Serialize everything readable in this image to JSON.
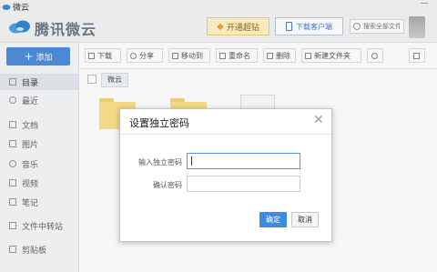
{
  "window": {
    "title": "微云"
  },
  "header": {
    "brand": "腾讯微云",
    "vip_label": "开通超钻",
    "download_client_label": "下载客户端",
    "search_placeholder": "搜索全部文件"
  },
  "sidebar": {
    "add_label": "添加",
    "items": [
      {
        "label": "目录",
        "icon": "directory-icon"
      },
      {
        "label": "最近",
        "icon": "clock-icon"
      },
      {
        "label": "文档",
        "icon": "document-icon"
      },
      {
        "label": "图片",
        "icon": "image-icon"
      },
      {
        "label": "音乐",
        "icon": "music-icon"
      },
      {
        "label": "视频",
        "icon": "video-icon"
      },
      {
        "label": "笔记",
        "icon": "note-icon"
      },
      {
        "label": "文件中转站",
        "icon": "transfer-icon"
      },
      {
        "label": "剪贴板",
        "icon": "clipboard-icon"
      }
    ]
  },
  "toolbar": {
    "download": "下载",
    "share": "分享",
    "move": "移动到",
    "rename": "重命名",
    "delete": "删除",
    "new_folder": "新建文件夹"
  },
  "breadcrumb": {
    "root": "微云"
  },
  "dialog": {
    "title": "设置独立密码",
    "password_label": "输入独立密码",
    "confirm_label": "确认密码",
    "password_value": "",
    "confirm_value": "",
    "ok_label": "确定",
    "cancel_label": "取消"
  },
  "colors": {
    "accent": "#4f8edc",
    "ok_button": "#3d8be0",
    "vip_background": "#fff2c6",
    "folder": "#fbdf8c"
  }
}
